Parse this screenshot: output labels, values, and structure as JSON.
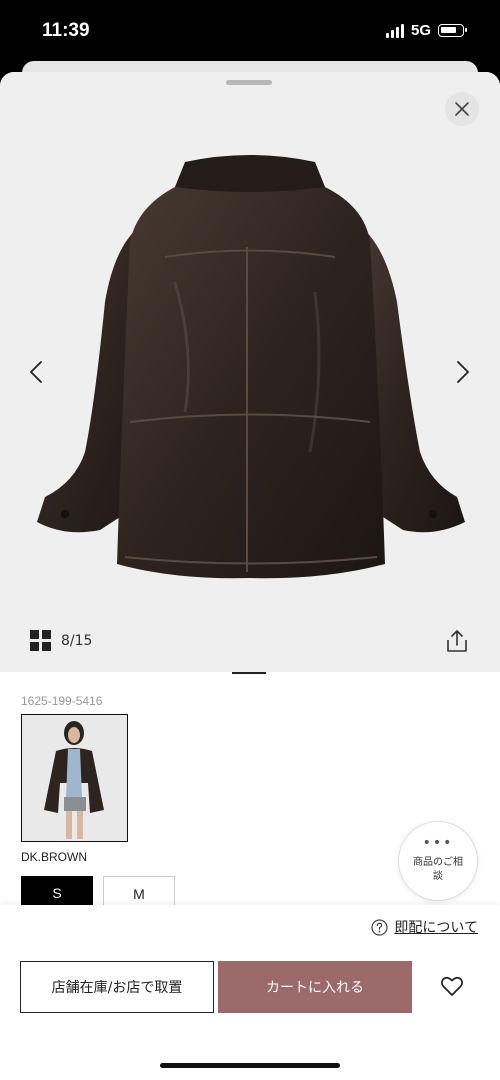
{
  "status_bar": {
    "time": "11:39",
    "network": "5G"
  },
  "gallery": {
    "counter": "8/15"
  },
  "product": {
    "code": "1625-199-5416",
    "color_name": "DK.BROWN",
    "sizes": [
      "S",
      "M"
    ],
    "selected_size": "S"
  },
  "consult": {
    "label": "商品のご相談"
  },
  "delivery": {
    "label": "即配について"
  },
  "actions": {
    "store_label": "店舗在庫/お店で取置",
    "cart_label": "カートに入れる"
  },
  "colors": {
    "cart_button": "#9c6a6a",
    "jacket": "#2e241f",
    "image_bg": "#efefef"
  },
  "icons": {
    "close": "close-icon",
    "prev": "chevron-left-icon",
    "next": "chevron-right-icon",
    "gallery_grid": "grid-icon",
    "share": "share-icon",
    "help": "question-circle-icon",
    "favorite": "heart-icon"
  }
}
